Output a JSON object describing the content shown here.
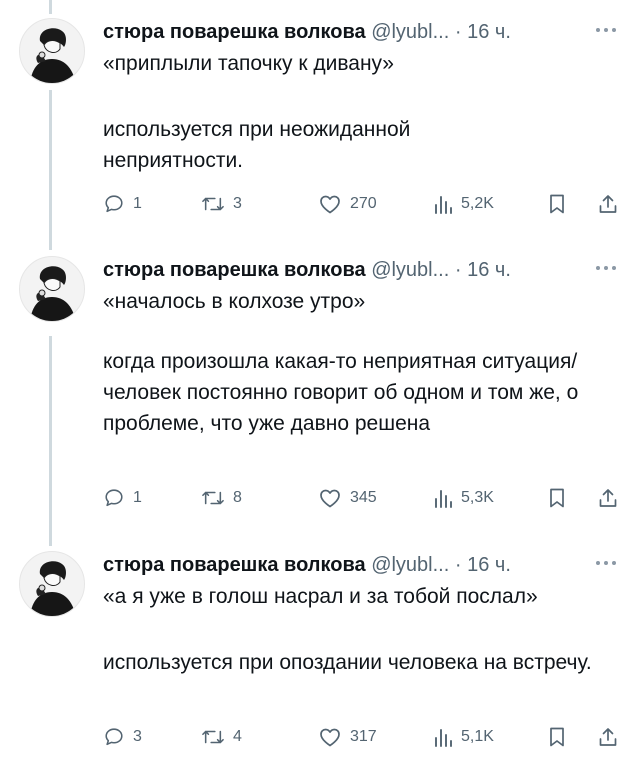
{
  "tweets": [
    {
      "author_name": "стюра поварешка волкова",
      "handle": "@lyubl...",
      "separator": "·",
      "time": "16 ч.",
      "quote": "«приплыли тапочку к дивану»",
      "explanation": "используется при неожиданной неприятности.",
      "replies": "1",
      "reposts": "3",
      "likes": "270",
      "views": "5,2K"
    },
    {
      "author_name": "стюра поварешка волкова",
      "handle": "@lyubl...",
      "separator": "·",
      "time": "16 ч.",
      "quote": "«началось в колхозе утро»",
      "explanation": "когда произошла какая-то неприятная ситуация/человек постоянно говорит об одном и том же, о проблеме, что уже давно решена",
      "replies": "1",
      "reposts": "8",
      "likes": "345",
      "views": "5,3K"
    },
    {
      "author_name": "стюра поварешка волкова",
      "handle": "@lyubl...",
      "separator": "·",
      "time": "16 ч.",
      "quote": "«а я уже в голош насрал и за тобой послал»",
      "explanation": "используется при опоздании человека на встречу.",
      "replies": "3",
      "reposts": "4",
      "likes": "317",
      "views": "5,1K"
    }
  ],
  "icons": {
    "reply": "speech-bubble-icon",
    "repost": "repost-arrows-icon",
    "like": "heart-icon",
    "views": "bar-chart-icon",
    "bookmark": "bookmark-icon",
    "share": "share-icon",
    "more": "more-dots-icon"
  },
  "colors": {
    "text": "#0f1419",
    "secondary": "#536471",
    "thread_line": "#cfd9de"
  }
}
